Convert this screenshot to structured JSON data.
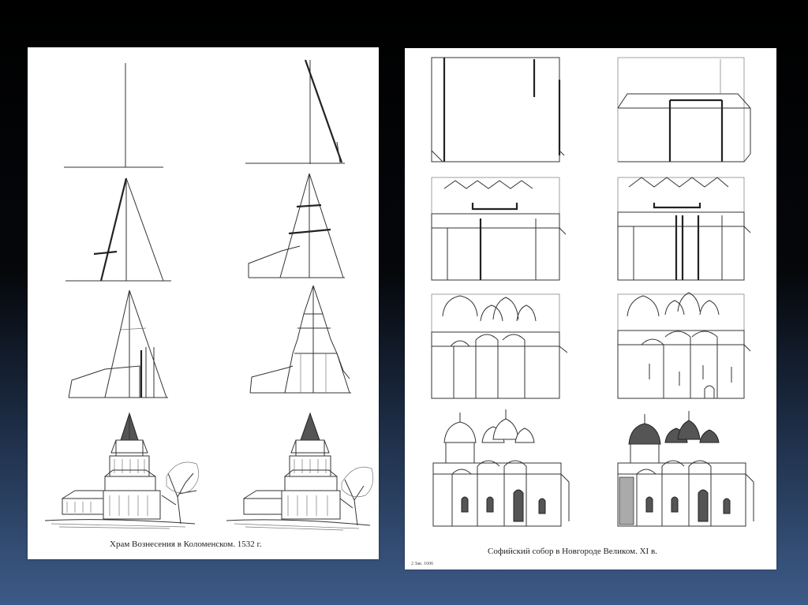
{
  "left_panel": {
    "caption": "Храм Вознесения в Коломенском. 1532 г."
  },
  "right_panel": {
    "caption": "Софийский собор в Новгороде Великом. XI в.",
    "footnote": "2 Зак. 1606"
  },
  "colors": {
    "background_top": "#000000",
    "background_bottom": "#3d5b88",
    "panel": "#ffffff",
    "ink": "#333333"
  }
}
